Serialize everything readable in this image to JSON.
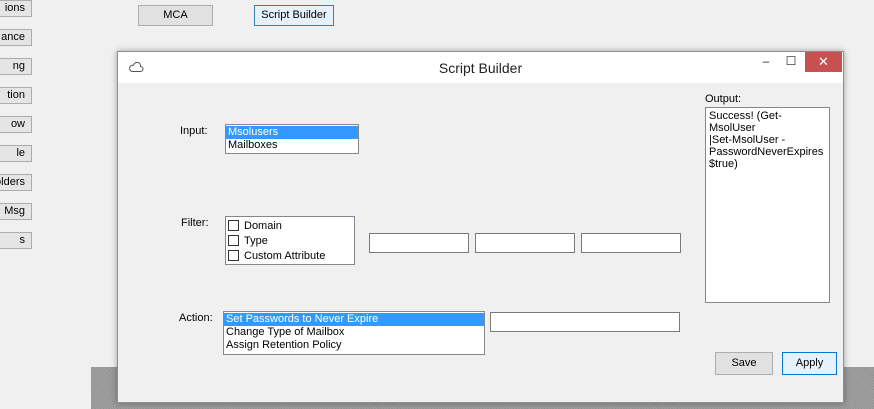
{
  "parent": {
    "side_buttons": [
      "ions",
      "ance",
      "ng",
      "tion",
      "ow",
      "le",
      "olders",
      "Msg",
      "s"
    ],
    "top_buttons": [
      "MCA",
      "Script Builder"
    ]
  },
  "dialog": {
    "title": "Script Builder",
    "controls": {
      "minimize": "–",
      "maximize": "☐",
      "close": "✕"
    },
    "input": {
      "label": "Input:",
      "items": [
        "Msolusers",
        "Mailboxes"
      ],
      "selected": "Msolusers"
    },
    "filter": {
      "label": "Filter:",
      "options": [
        "Domain",
        "Type",
        "Custom Attribute"
      ],
      "fields": [
        "",
        "",
        ""
      ]
    },
    "action": {
      "label": "Action:",
      "items": [
        "Set Passwords to Never Expire",
        "Change Type of Mailbox",
        "Assign Retention Policy"
      ],
      "selected": "Set Passwords to Never Expire",
      "field": ""
    },
    "output": {
      "label": "Output:",
      "lines": [
        "Success! (Get-MsolUser",
        "|Set-MsolUser -",
        "PasswordNeverExpires",
        "$true)"
      ]
    },
    "buttons": {
      "save": "Save",
      "apply": "Apply"
    }
  }
}
